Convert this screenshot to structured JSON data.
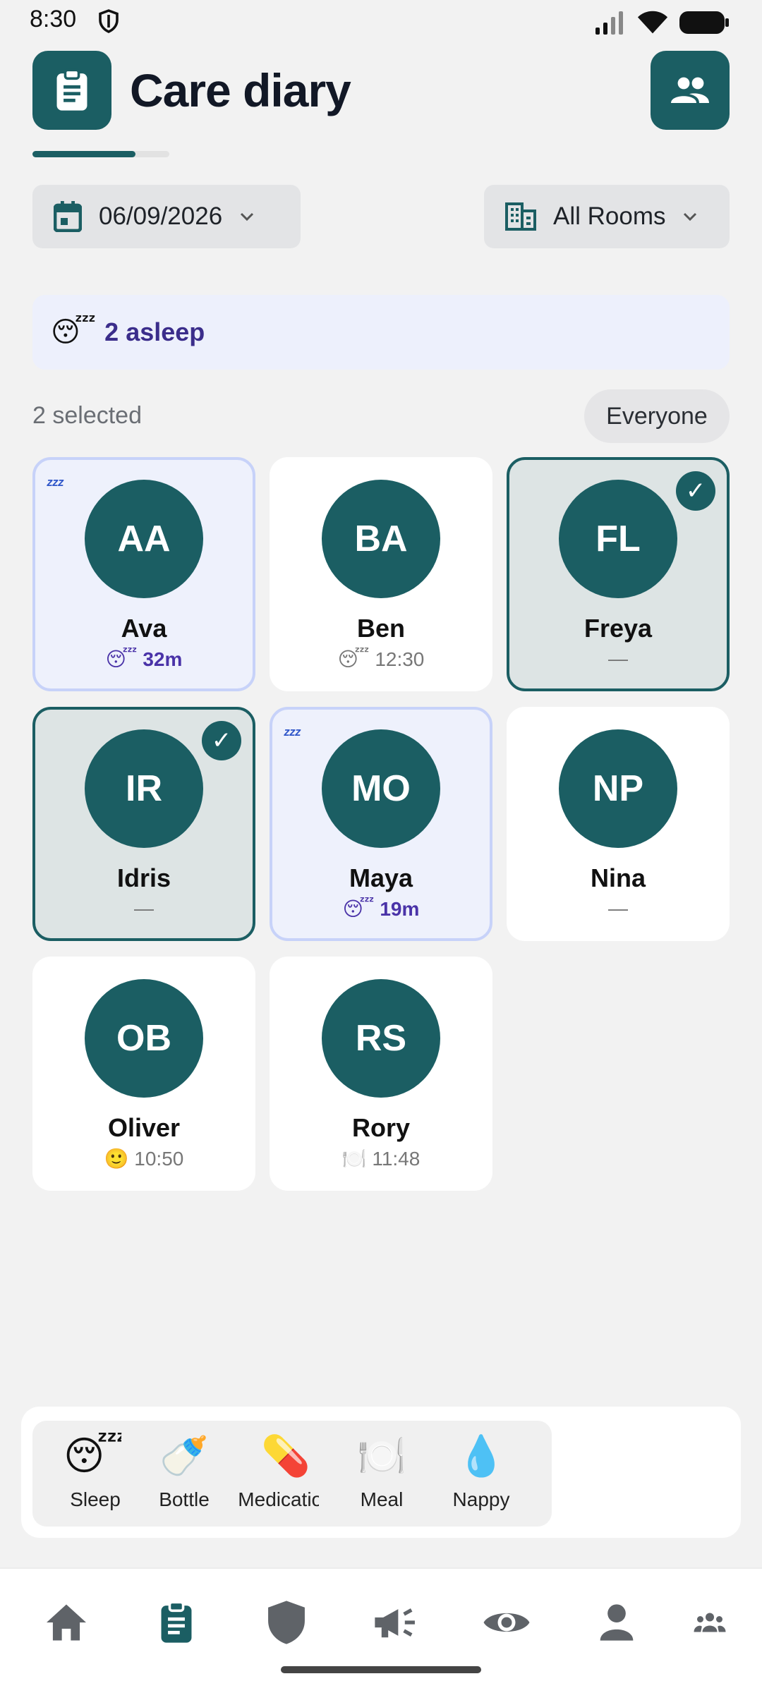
{
  "status_bar": {
    "time": "8:30"
  },
  "header": {
    "title": "Care diary",
    "progress_fraction": 0.75
  },
  "filters": {
    "date": "06/09/2026",
    "room": "All Rooms"
  },
  "banner": {
    "emoji": "😴",
    "text": "2 asleep"
  },
  "selection": {
    "count_label": "2 selected",
    "everyone_label": "Everyone"
  },
  "children": [
    {
      "initials": "AA",
      "name": "Ava",
      "status_icon": "😴",
      "status": "32m",
      "state": "asleep"
    },
    {
      "initials": "BA",
      "name": "Ben",
      "status_icon": "😴",
      "status": "12:30",
      "state": "normal"
    },
    {
      "initials": "FL",
      "name": "Freya",
      "status_icon": "",
      "status": "—",
      "state": "selected"
    },
    {
      "initials": "IR",
      "name": "Idris",
      "status_icon": "",
      "status": "—",
      "state": "selected"
    },
    {
      "initials": "MO",
      "name": "Maya",
      "status_icon": "😴",
      "status": "19m",
      "state": "asleep"
    },
    {
      "initials": "NP",
      "name": "Nina",
      "status_icon": "",
      "status": "—",
      "state": "normal"
    },
    {
      "initials": "OB",
      "name": "Oliver",
      "status_icon": "🙂",
      "status": "10:50",
      "state": "normal"
    },
    {
      "initials": "RS",
      "name": "Rory",
      "status_icon": "🍽️",
      "status": "11:48",
      "state": "normal"
    }
  ],
  "actions": [
    {
      "icon": "😴",
      "label": "Sleep"
    },
    {
      "icon": "🍼",
      "label": "Bottle"
    },
    {
      "icon": "💊",
      "label": "Medication"
    },
    {
      "icon": "🍽️",
      "label": "Meal"
    },
    {
      "icon": "💧",
      "label": "Nappy"
    }
  ],
  "colors": {
    "primary": "#1b5e63",
    "asleep_bg": "#eef1fc",
    "asleep_border": "#c7d2f9",
    "asleep_text": "#3b2d8b"
  },
  "nav_icons": [
    "home-icon",
    "clipboard-icon",
    "shield-icon",
    "megaphone-icon",
    "eye-icon",
    "person-icon",
    "group-icon"
  ]
}
